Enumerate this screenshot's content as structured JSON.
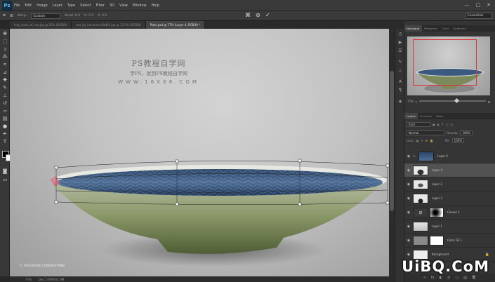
{
  "app": {
    "logo": "Ps"
  },
  "menu": [
    "File",
    "Edit",
    "Image",
    "Layer",
    "Type",
    "Select",
    "Filter",
    "3D",
    "View",
    "Window",
    "Help"
  ],
  "window_controls": {
    "minimize": "—",
    "maximize": "□",
    "close": "✕"
  },
  "options": {
    "warp_label": "Warp:",
    "warp_value": "Custom",
    "bend": "Bend: 0.0",
    "h": "H: 0.0",
    "v": "V: 0.0",
    "cancel": "⊘",
    "commit": "✓",
    "workspace": "Essentials"
  },
  "tabs": [
    {
      "label": "tray_stock_of_sea.jpg @ 50% (RGB/8)"
    },
    {
      "label": "sea_by_honolulu-d3b6fa.jpg @ 33.3% (RGB/8)"
    },
    {
      "label": "Plate.psd @ 77% (Layer 4, RGB/8) *",
      "active": true
    }
  ],
  "watermark": {
    "line1": "PS教程自学网",
    "line2": "学PS，就到PS教程自学网",
    "line3": "WWW.16XX8.COM"
  },
  "credit": "© FACEBOOK.COM/RAFYABB",
  "status": {
    "zoom": "77%",
    "doc": "Doc: 5.90M/51.9M"
  },
  "panels": {
    "nav_tabs": [
      "Navigator",
      "Histogram",
      "Color",
      "Swatches"
    ],
    "zoom_value": "77%",
    "layer_tabs": [
      "Layers",
      "Channels",
      "Paths"
    ],
    "kind": "Kind",
    "blend": "Normal",
    "opacity_label": "Opacity:",
    "opacity": "100%",
    "lock_label": "Lock:",
    "fill_label": "Fill:",
    "fill": "100%"
  },
  "layers": [
    {
      "name": "Layer 5",
      "thumb": "water"
    },
    {
      "name": "Layer 4",
      "thumb": "plate-top",
      "selected": true
    },
    {
      "name": "Layer 2",
      "thumb": "rim"
    },
    {
      "name": "Layer 3",
      "thumb": "shadow"
    },
    {
      "name": "Curves 1",
      "thumb": "curves",
      "mask": "gradient"
    },
    {
      "name": "Layer 1",
      "thumb": "plate"
    },
    {
      "name": "Color Fill 1",
      "thumb": "fill",
      "mask": "white"
    },
    {
      "name": "Background",
      "thumb": "bg",
      "locked": true
    }
  ],
  "layer_footer": [
    "∞",
    "fx",
    "◐",
    "⊘",
    "▭",
    "▤",
    "🗑"
  ],
  "brand": "UiBQ.CoM",
  "colors": {
    "accent": "#e03030",
    "canvas": "#c2c2c2",
    "panel": "#353535"
  }
}
